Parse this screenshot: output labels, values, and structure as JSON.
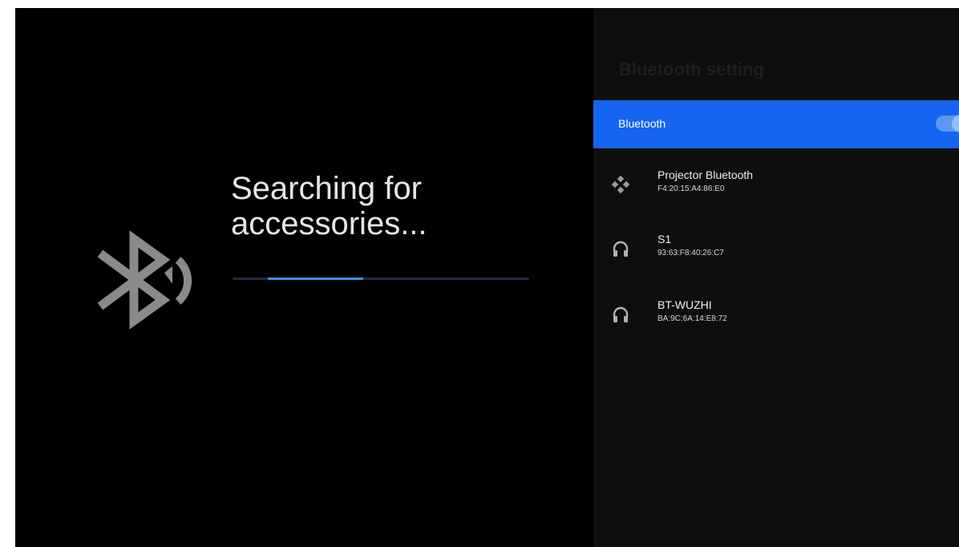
{
  "search": {
    "title": "Searching for\naccessories...",
    "progress_start": 0.12,
    "progress_end": 0.44
  },
  "panel": {
    "title": "Bluetooth setting",
    "bluetooth_label": "Bluetooth",
    "bluetooth_enabled": true
  },
  "devices": [
    {
      "name": "Projector Bluetooth",
      "mac": "F4:20:15:A4:86:E0",
      "icon": "gamepad-icon"
    },
    {
      "name": "S1",
      "mac": "93:63:F8:40:26:C7",
      "icon": "headphones-icon"
    },
    {
      "name": "BT-WUZHI",
      "mac": "BA:9C:6A:14:E8:72",
      "icon": "headphones-icon"
    }
  ],
  "colors": {
    "accent": "#1565f0",
    "progress": "#3f8fe0",
    "background": "#000000",
    "panel": "#0e0e0e"
  }
}
